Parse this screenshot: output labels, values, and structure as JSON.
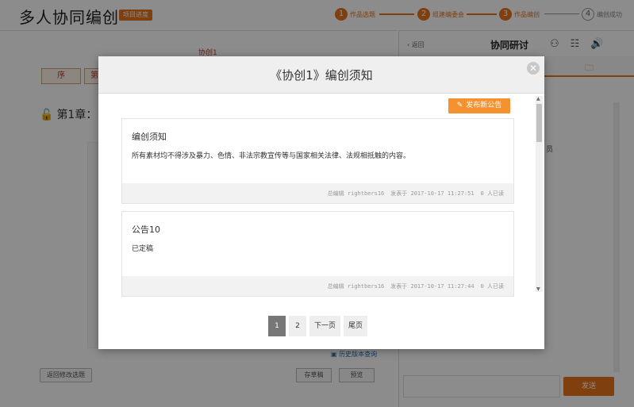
{
  "header": {
    "app_title": "多人协同编创",
    "project_badge": "项目进度",
    "steps": [
      {
        "num": "1",
        "label": "作品选题"
      },
      {
        "num": "2",
        "label": "组建编委会"
      },
      {
        "num": "3",
        "label": "作品编创"
      },
      {
        "num": "4",
        "label": "编创成功"
      }
    ]
  },
  "editor": {
    "doc_label": "协创1",
    "tabs": [
      "序",
      "第"
    ],
    "chapter_title": "第1章：",
    "history_link": "历史版本查询",
    "back_button": "返回修改选题",
    "draft_button": "存草稿",
    "preview_button": "预览"
  },
  "sidebar": {
    "back_label": "返回",
    "title": "协同研讨",
    "text_fragment": "员",
    "send_button": "发送"
  },
  "modal": {
    "title": "《协创1》编创须知",
    "publish_button": "发布新公告",
    "notices": [
      {
        "title": "编创须知",
        "content": "所有素材均不得涉及暴力、色情、非法宗教宣传等与国家相关法律、法规相抵触的内容。",
        "author": "总编辑 rightbers16",
        "published": "发表于 2017-10-17 11:27:51",
        "reads": "0 人已读"
      },
      {
        "title": "公告10",
        "content": "已定稿",
        "author": "总编辑 rightbers16",
        "published": "发表于 2017-10-17 11:27:44",
        "reads": "0 人已读"
      }
    ],
    "pagination": {
      "pages": [
        "1",
        "2"
      ],
      "current": "1",
      "next_label": "下一页",
      "last_label": "尾页"
    }
  },
  "colors": {
    "accent": "#e8731d",
    "publish_button": "#f5922f",
    "active_page": "#777777"
  },
  "icons": [
    "plus-circle-icon",
    "close-icon",
    "lock-icon",
    "user-icon",
    "org-chart-icon",
    "speaker-icon",
    "folder-icon",
    "edit-icon",
    "history-icon"
  ]
}
